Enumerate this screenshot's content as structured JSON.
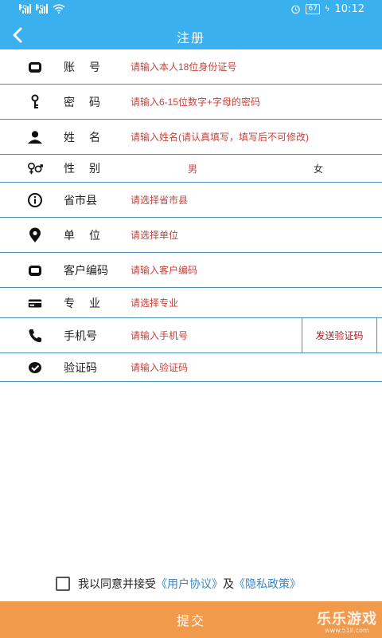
{
  "status_bar": {
    "signal_1": "4G",
    "signal_2": "4G",
    "battery": "67",
    "time": "10:12"
  },
  "header": {
    "title": "注册"
  },
  "form": {
    "account_label": "账号",
    "account_placeholder": "请输入本人18位身份证号",
    "password_label": "密码",
    "password_placeholder": "请输入6-15位数字+字母的密码",
    "name_label": "姓名",
    "name_placeholder": "请输入姓名(请认真填写，填写后不可修改)",
    "gender_label": "性别",
    "gender_male": "男",
    "gender_female": "女",
    "region_label": "省市县",
    "region_placeholder": "请选择省市县",
    "unit_label": "单位",
    "unit_placeholder": "请选择单位",
    "customer_code_label": "客户编码",
    "customer_code_placeholder": "请输入客户编码",
    "major_label": "专业",
    "major_placeholder": "请选择专业",
    "phone_label": "手机号",
    "phone_placeholder": "请输入手机号",
    "send_code_label": "发送验证码",
    "code_label": "验证码",
    "code_placeholder": "请输入验证码"
  },
  "agreement": {
    "prefix": "我以同意并接受",
    "user_agreement": "《用户协议》",
    "and": "及",
    "privacy_policy": "《隐私政策》"
  },
  "submit_label": "提交",
  "watermark": {
    "title": "乐乐游戏",
    "url": "www.51ll.com"
  },
  "colors": {
    "primary": "#3ab0ef",
    "placeholder": "#c9413b",
    "divider": "#4a93b7",
    "submit": "#f29a4b",
    "link": "#3a86c8"
  }
}
